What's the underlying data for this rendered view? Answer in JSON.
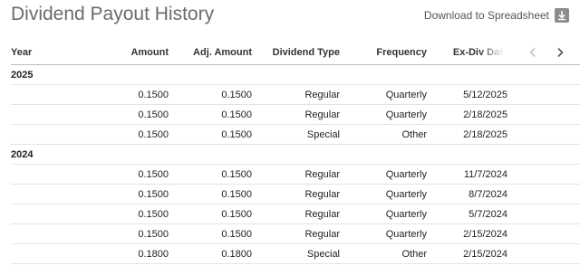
{
  "title": "Dividend Payout History",
  "download": {
    "label": "Download to Spreadsheet",
    "icon": "download-icon"
  },
  "nav": {
    "prev_icon": "chevron-left-icon",
    "next_icon": "chevron-right-icon"
  },
  "headers": {
    "year": "Year",
    "amount": "Amount",
    "adj_amount": "Adj. Amount",
    "dividend_type": "Dividend Type",
    "frequency": "Frequency",
    "ex_div_date": "Ex-Div Date"
  },
  "groups": [
    {
      "year": "2025",
      "rows": [
        {
          "amount": "0.1500",
          "adj_amount": "0.1500",
          "type": "Regular",
          "frequency": "Quarterly",
          "ex_div_date": "5/12/2025",
          "next": "5/"
        },
        {
          "amount": "0.1500",
          "adj_amount": "0.1500",
          "type": "Regular",
          "frequency": "Quarterly",
          "ex_div_date": "2/18/2025",
          "next": "2/"
        },
        {
          "amount": "0.1500",
          "adj_amount": "0.1500",
          "type": "Special",
          "frequency": "Other",
          "ex_div_date": "2/18/2025",
          "next": "2/"
        }
      ]
    },
    {
      "year": "2024",
      "rows": [
        {
          "amount": "0.1500",
          "adj_amount": "0.1500",
          "type": "Regular",
          "frequency": "Quarterly",
          "ex_div_date": "11/7/2024",
          "next": "11"
        },
        {
          "amount": "0.1500",
          "adj_amount": "0.1500",
          "type": "Regular",
          "frequency": "Quarterly",
          "ex_div_date": "8/7/2024",
          "next": "8"
        },
        {
          "amount": "0.1500",
          "adj_amount": "0.1500",
          "type": "Regular",
          "frequency": "Quarterly",
          "ex_div_date": "5/7/2024",
          "next": "5"
        },
        {
          "amount": "0.1500",
          "adj_amount": "0.1500",
          "type": "Regular",
          "frequency": "Quarterly",
          "ex_div_date": "2/15/2024",
          "next": "2/"
        },
        {
          "amount": "0.1800",
          "adj_amount": "0.1800",
          "type": "Special",
          "frequency": "Other",
          "ex_div_date": "2/15/2024",
          "next": "2/"
        }
      ]
    }
  ]
}
